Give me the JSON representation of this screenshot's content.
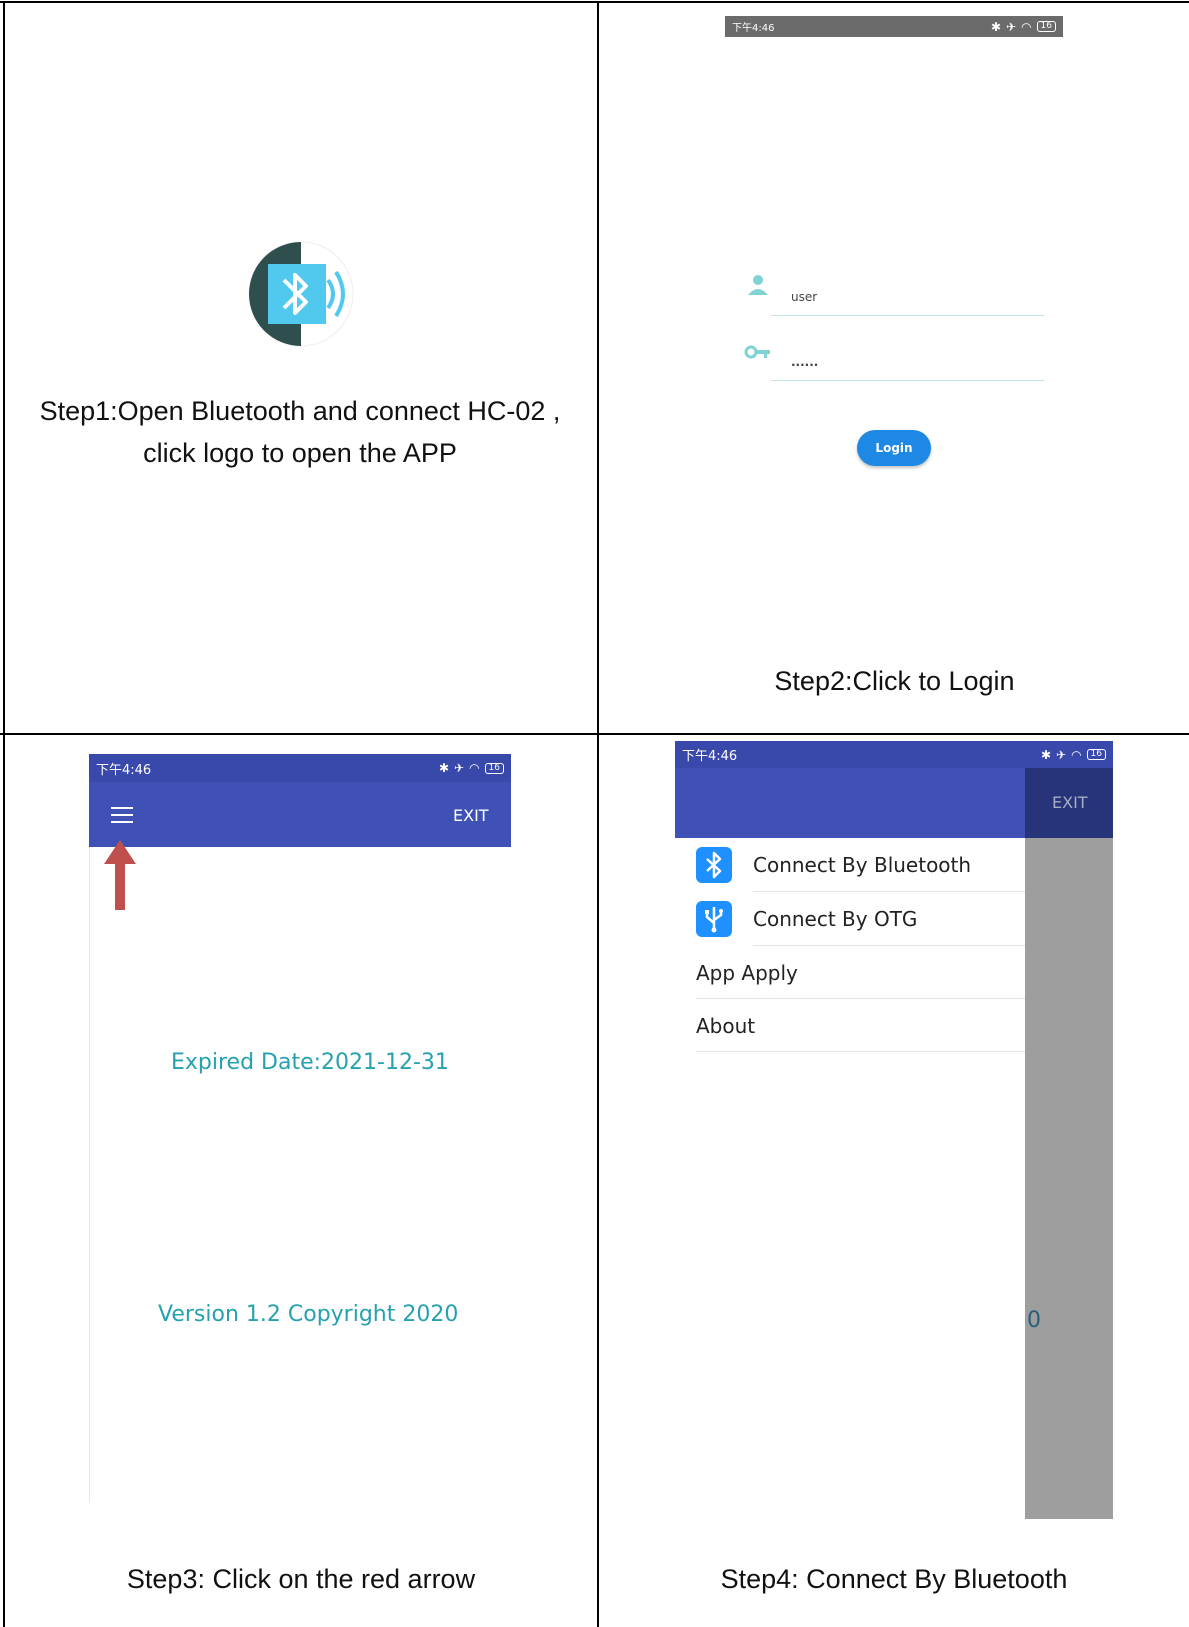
{
  "steps": {
    "step1": {
      "caption_line1": "Step1:Open Bluetooth and connect HC-02 ,",
      "caption_line2": "click logo to open the APP"
    },
    "step2": {
      "caption": "Step2:Click to Login"
    },
    "step3": {
      "caption": "Step3:  Click on the red arrow"
    },
    "step4": {
      "caption": "Step4:  Connect By Bluetooth"
    }
  },
  "status_bar": {
    "time": "下午4:46",
    "battery": "16"
  },
  "login": {
    "username": "user",
    "password": "......",
    "button_label": "Login"
  },
  "main_screen": {
    "exit_label": "EXIT",
    "expired": "Expired Date:2021-12-31",
    "version": "Version 1.2 Copyright 2020"
  },
  "drawer": {
    "exit_label": "EXIT",
    "items": [
      {
        "label": "Connect By Bluetooth",
        "icon": "bluetooth-icon"
      },
      {
        "label": "Connect By OTG",
        "icon": "usb-icon"
      },
      {
        "label": "App Apply"
      },
      {
        "label": "About"
      }
    ],
    "partial_value": "0"
  },
  "colors": {
    "app_bar": "#3f51b5",
    "teal_text": "#26a1b0",
    "login_button": "#1e88e5",
    "red_arrow": "#c0504d",
    "scrim": "#9e9e9e"
  }
}
